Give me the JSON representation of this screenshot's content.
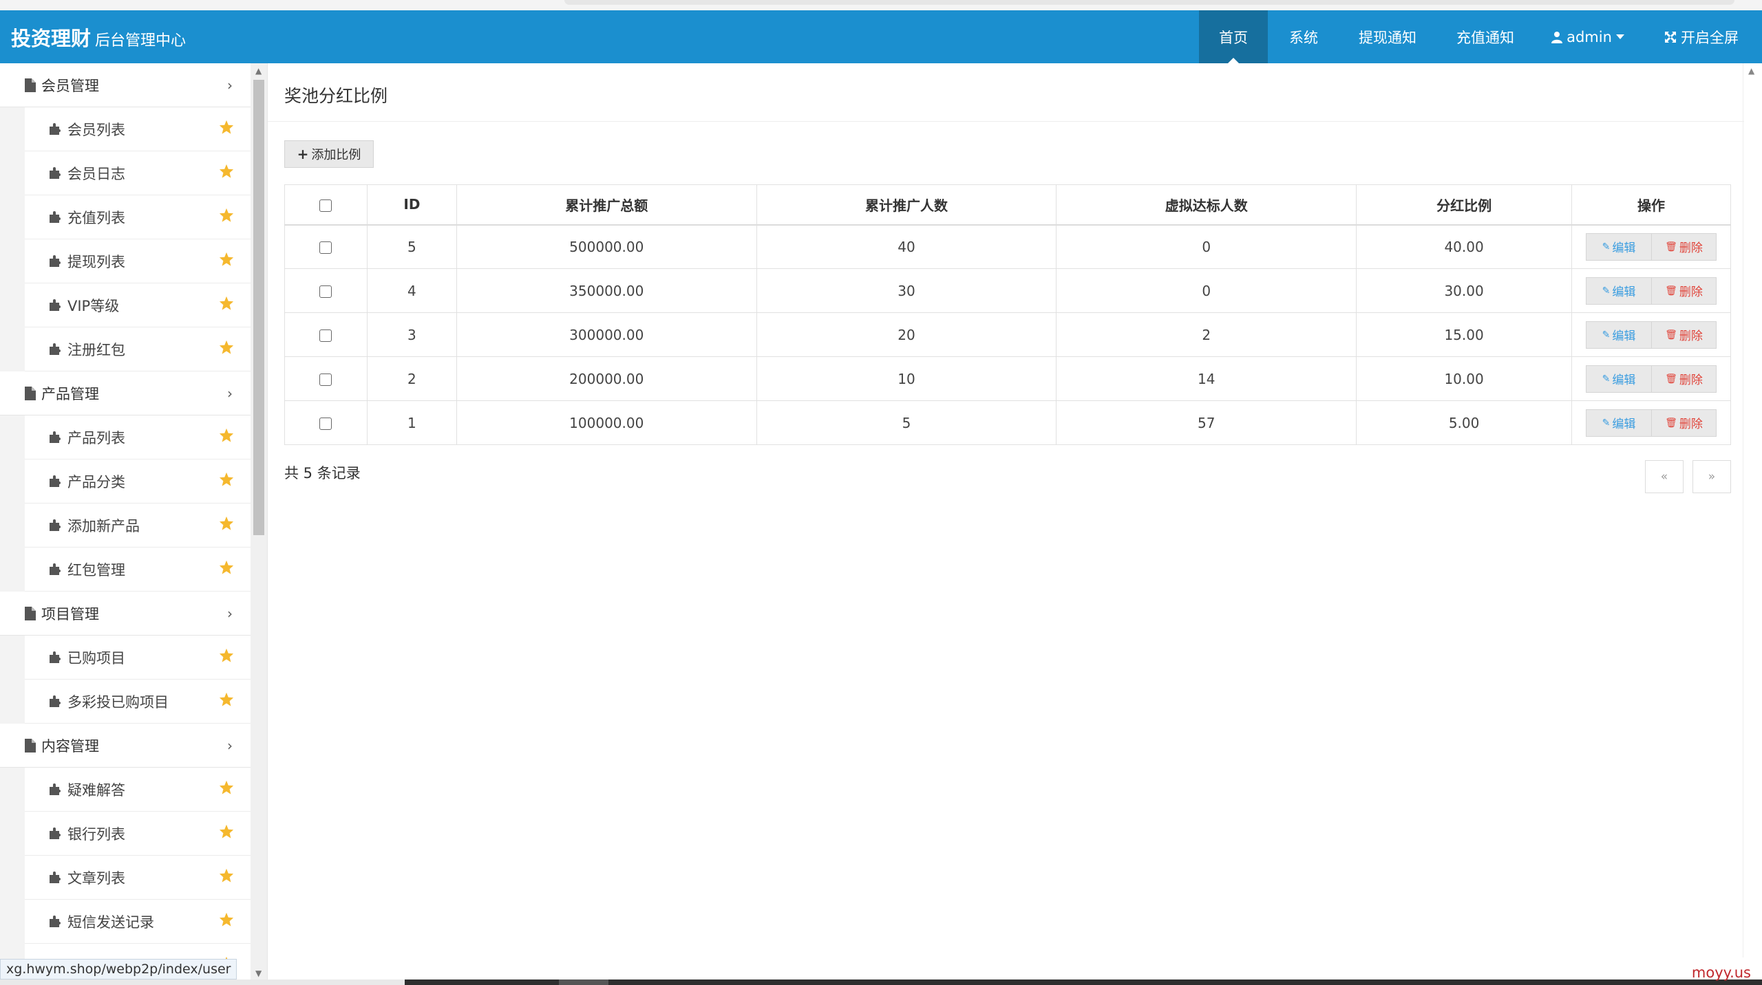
{
  "header": {
    "brand_main": "投资理财",
    "brand_sub": "后台管理中心",
    "nav": [
      {
        "label": "首页",
        "active": true
      },
      {
        "label": "系统"
      },
      {
        "label": "提现通知"
      },
      {
        "label": "充值通知"
      },
      {
        "label": "admin",
        "icon": "user-icon",
        "caret": true
      },
      {
        "label": "开启全屏",
        "icon": "fullscreen-icon"
      }
    ]
  },
  "sidebar": {
    "groups": [
      {
        "label": "会员管理",
        "items": [
          "会员列表",
          "会员日志",
          "充值列表",
          "提现列表",
          "VIP等级",
          "注册红包"
        ]
      },
      {
        "label": "产品管理",
        "items": [
          "产品列表",
          "产品分类",
          "添加新产品",
          "红包管理"
        ]
      },
      {
        "label": "项目管理",
        "items": [
          "已购项目",
          "多彩投已购项目"
        ]
      },
      {
        "label": "内容管理",
        "items": [
          "疑难解答",
          "银行列表",
          "文章列表",
          "短信发送记录",
          ""
        ]
      }
    ]
  },
  "page": {
    "title": "奖池分红比例",
    "add_button": "添加比例"
  },
  "table": {
    "columns": [
      "ID",
      "累计推广总额",
      "累计推广人数",
      "虚拟达标人数",
      "分红比例",
      "操作"
    ],
    "rows": [
      [
        "5",
        "500000.00",
        "40",
        "0",
        "40.00"
      ],
      [
        "4",
        "350000.00",
        "30",
        "0",
        "30.00"
      ],
      [
        "3",
        "300000.00",
        "20",
        "2",
        "15.00"
      ],
      [
        "2",
        "200000.00",
        "10",
        "14",
        "10.00"
      ],
      [
        "1",
        "100000.00",
        "5",
        "57",
        "5.00"
      ]
    ],
    "edit_label": "编辑",
    "delete_label": "删除"
  },
  "footer": {
    "record_count": "共 5 条记录",
    "prev": "«",
    "next": "»"
  },
  "status_url": "xg.hwym.shop/webp2p/index/user",
  "watermark": "moyy.us",
  "colors": {
    "header_bg": "#1b8fcf",
    "nav_active_bg": "#166f9e",
    "star": "#f5b82e",
    "edit": "#3a9de0",
    "delete": "#e0443a"
  }
}
